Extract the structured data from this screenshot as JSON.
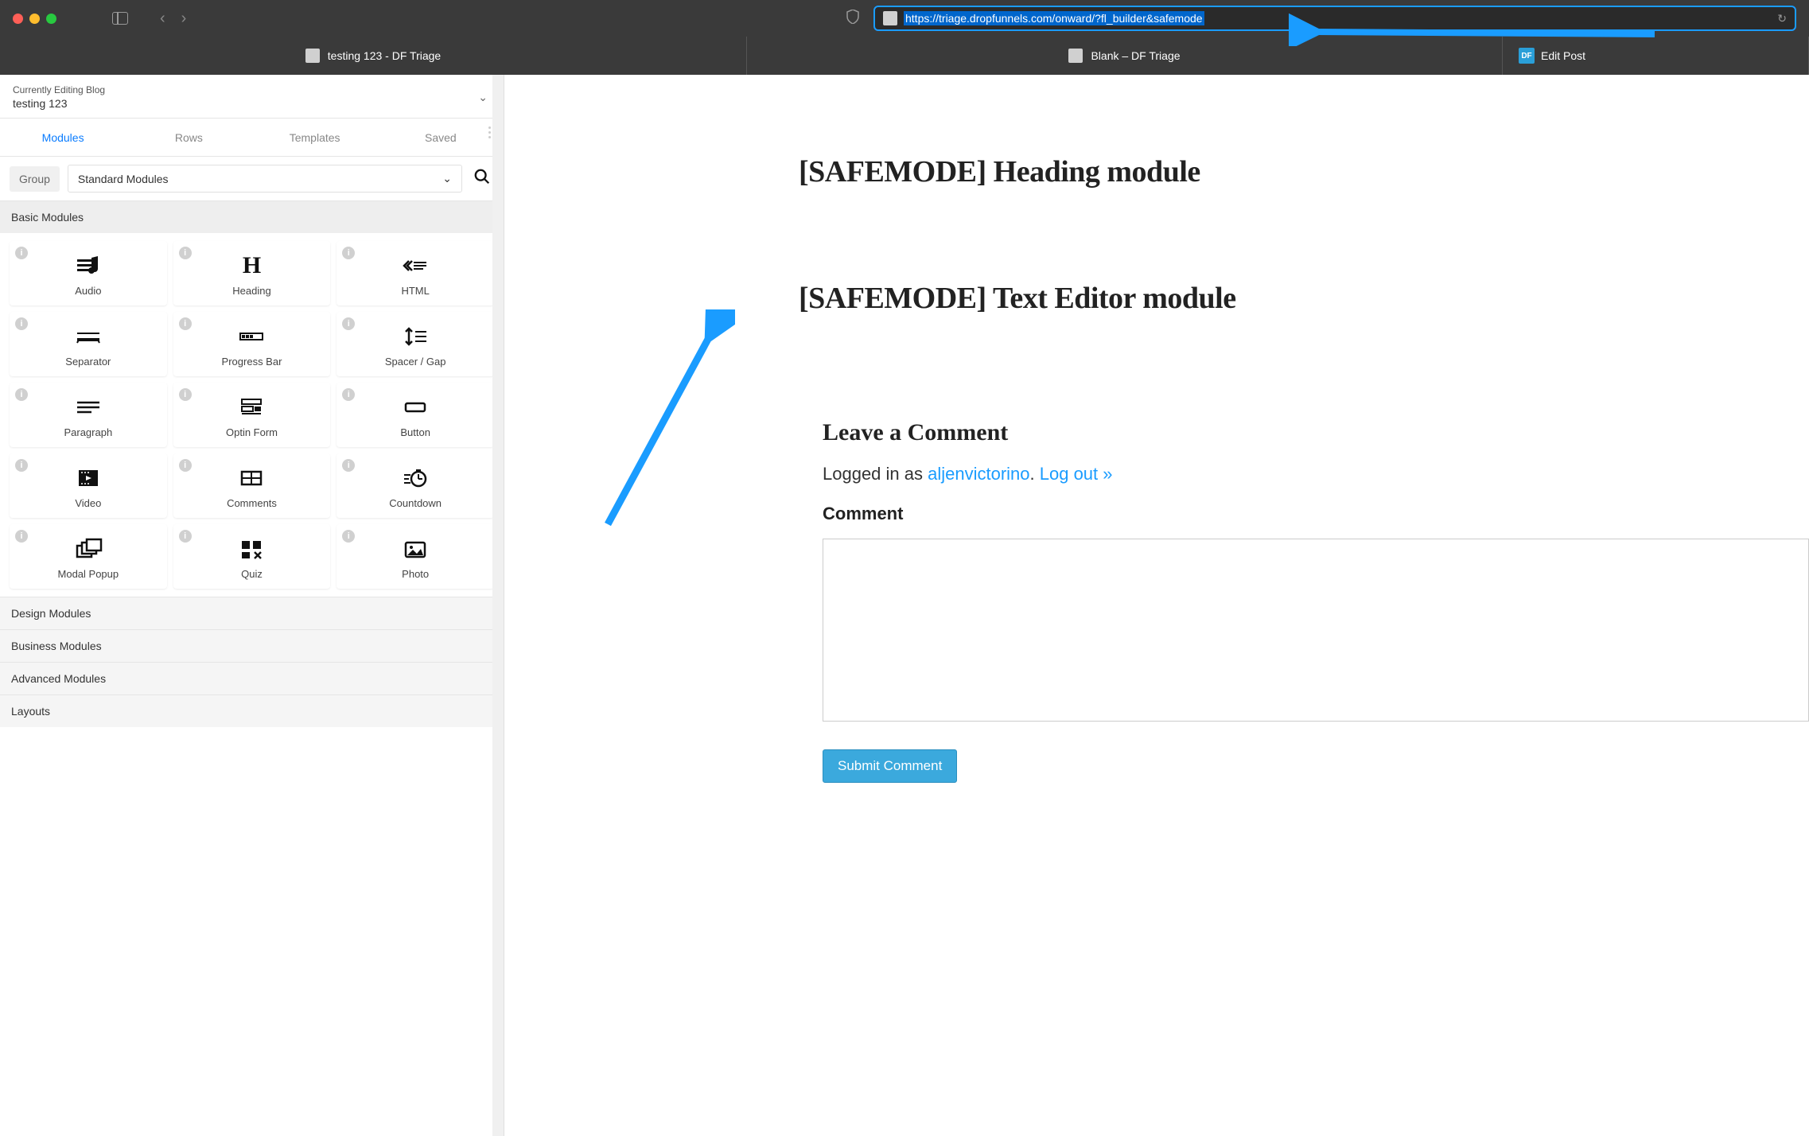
{
  "browser": {
    "url": "https://triage.dropfunnels.com/onward/?fl_builder&safemode",
    "tabs": [
      {
        "label": "testing 123 - DF Triage"
      },
      {
        "label": "Blank – DF Triage"
      },
      {
        "label": "Edit Post",
        "badge": "DF"
      }
    ]
  },
  "sidebar": {
    "editing_label": "Currently Editing Blog",
    "editing_title": "testing 123",
    "panel_tabs": [
      "Modules",
      "Rows",
      "Templates",
      "Saved"
    ],
    "active_tab": "Modules",
    "group_label": "Group",
    "group_selected": "Standard Modules",
    "sections": {
      "basic": {
        "title": "Basic Modules",
        "modules": [
          {
            "label": "Audio",
            "icon": "audio"
          },
          {
            "label": "Heading",
            "icon": "heading"
          },
          {
            "label": "HTML",
            "icon": "html"
          },
          {
            "label": "Separator",
            "icon": "separator"
          },
          {
            "label": "Progress Bar",
            "icon": "progress"
          },
          {
            "label": "Spacer / Gap",
            "icon": "spacer"
          },
          {
            "label": "Paragraph",
            "icon": "paragraph"
          },
          {
            "label": "Optin Form",
            "icon": "optin"
          },
          {
            "label": "Button",
            "icon": "button"
          },
          {
            "label": "Video",
            "icon": "video"
          },
          {
            "label": "Comments",
            "icon": "comments"
          },
          {
            "label": "Countdown",
            "icon": "countdown"
          },
          {
            "label": "Modal Popup",
            "icon": "modal"
          },
          {
            "label": "Quiz",
            "icon": "quiz"
          },
          {
            "label": "Photo",
            "icon": "photo"
          }
        ]
      },
      "collapsed": [
        "Design Modules",
        "Business Modules",
        "Advanced Modules",
        "Layouts"
      ]
    }
  },
  "canvas": {
    "heading": "[SAFEMODE] Heading module",
    "text_editor": "[SAFEMODE] Text Editor module",
    "comments": {
      "title": "Leave a Comment",
      "logged_prefix": "Logged in as ",
      "username": "aljenvictorino",
      "period": ". ",
      "logout": "Log out »",
      "field_label": "Comment",
      "submit": "Submit Comment"
    }
  }
}
